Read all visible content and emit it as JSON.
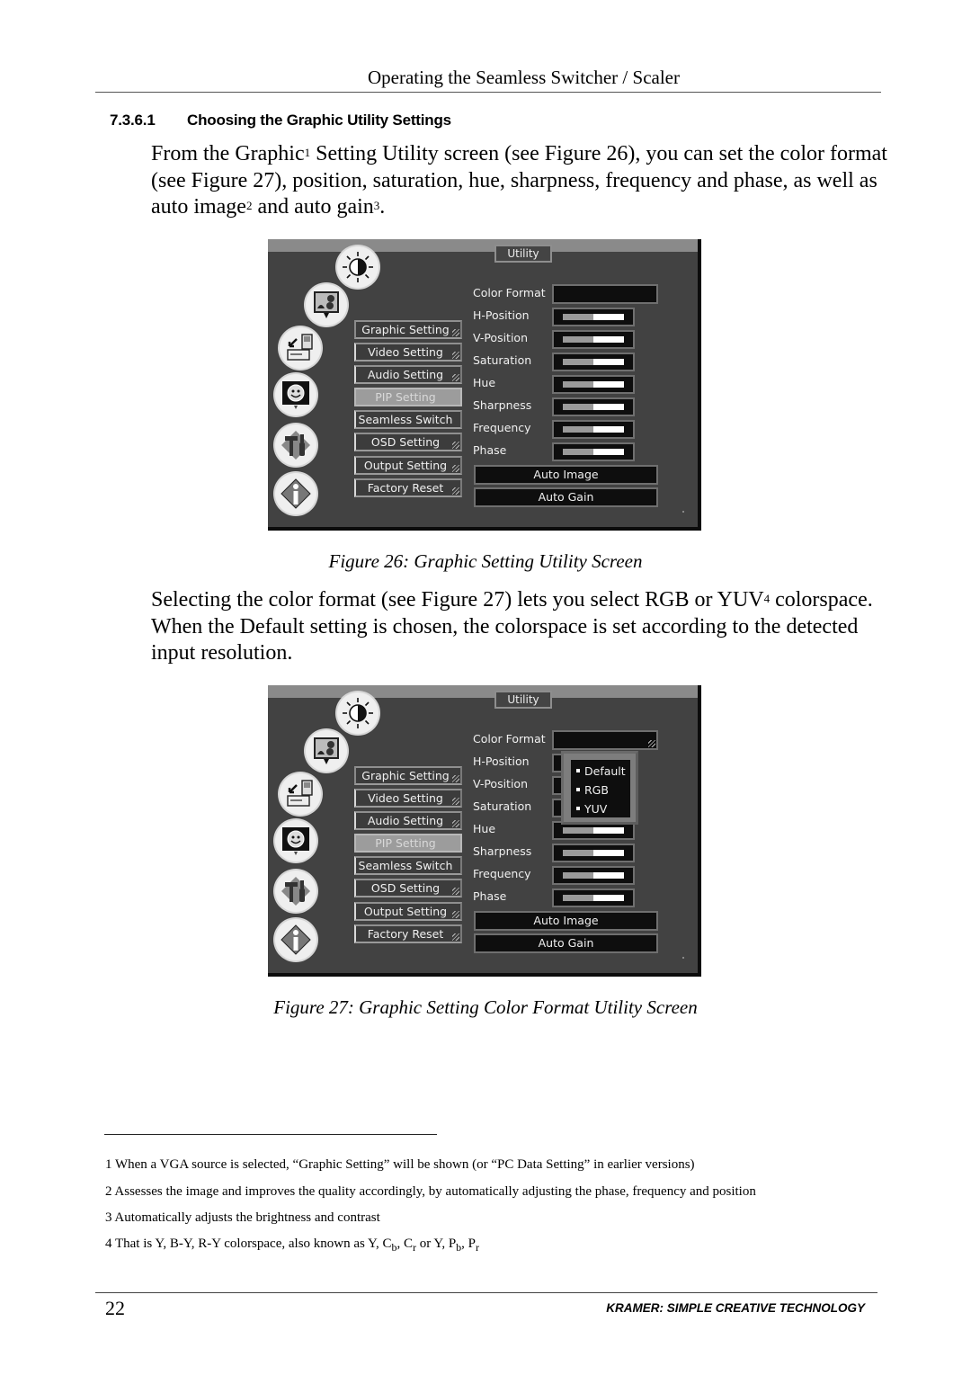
{
  "header": {
    "running_title": "Operating the Seamless Switcher / Scaler"
  },
  "section": {
    "number": "7.3.6.1",
    "title": "Choosing the Graphic Utility Settings"
  },
  "paragraph1": {
    "p1": "From the Graphic",
    "sup1": "1",
    "p2": " Setting Utility screen (see Figure 26), you can set the color format (see Figure 27), position, saturation, hue, sharpness, frequency and phase, as well as auto image",
    "sup2": "2",
    "p3": " and auto gain",
    "sup3": "3",
    "p4": "."
  },
  "figure26": {
    "caption": "Figure 26: Graphic Setting Utility Screen"
  },
  "paragraph2": {
    "p1": "Selecting the color format (see Figure 27) lets you select RGB or YUV",
    "sup1": "4",
    "p2": " colorspace. When the Default setting is chosen, the colorspace is set according to the detected input resolution."
  },
  "figure27": {
    "caption": "Figure 27: Graphic Setting Color Format Utility Screen"
  },
  "osd": {
    "tab_label": "Utility",
    "side_icons": [
      "brightness-contrast-icon",
      "picture-monitor-icon",
      "input-device-icon",
      "pip-smiley-icon",
      "tools-icon",
      "info-icon"
    ],
    "menu": [
      {
        "label": "Graphic Setting",
        "state": "selected"
      },
      {
        "label": "Video Setting",
        "state": "normal"
      },
      {
        "label": "Audio Setting",
        "state": "normal"
      },
      {
        "label": "PIP Setting",
        "state": "disabled"
      },
      {
        "label": "Seamless Switch",
        "state": "normal"
      },
      {
        "label": "OSD Setting",
        "state": "normal"
      },
      {
        "label": "Output Setting",
        "state": "normal"
      },
      {
        "label": "Factory Reset",
        "state": "normal"
      }
    ],
    "params": [
      {
        "label": "Color Format",
        "type": "select",
        "value": ""
      },
      {
        "label": "H-Position",
        "type": "slider",
        "value_pct": 50
      },
      {
        "label": "V-Position",
        "type": "slider",
        "value_pct": 50
      },
      {
        "label": "Saturation",
        "type": "slider",
        "value_pct": 50
      },
      {
        "label": "Hue",
        "type": "slider",
        "value_pct": 50
      },
      {
        "label": "Sharpness",
        "type": "slider",
        "value_pct": 50
      },
      {
        "label": "Frequency",
        "type": "slider",
        "value_pct": 50
      },
      {
        "label": "Phase",
        "type": "slider",
        "value_pct": 50
      }
    ],
    "auto_image_label": "Auto Image",
    "auto_gain_label": "Auto Gain",
    "color_format_options": [
      "Default",
      "RGB",
      "YUV"
    ]
  },
  "footnotes": {
    "fn1": "1 When a VGA source is selected, “Graphic Setting” will be shown (or “PC Data Setting” in earlier versions)",
    "fn2": "2 Assesses the image and improves the quality accordingly, by automatically adjusting the phase, frequency and position",
    "fn3": "3 Automatically adjusts the brightness and contrast",
    "fn4": {
      "text": "4 That is Y, B-Y, R-Y colorspace, also known as Y, C",
      "cb_sub": "b",
      "sep1": ", C",
      "cr_sub": "r",
      "sep2": " or Y, P",
      "pb_sub": "b",
      "sep3": ", P",
      "pr_sub": "r"
    }
  },
  "footer": {
    "page_number": "22",
    "brand": "KRAMER:  SIMPLE CREATIVE TECHNOLOGY"
  }
}
